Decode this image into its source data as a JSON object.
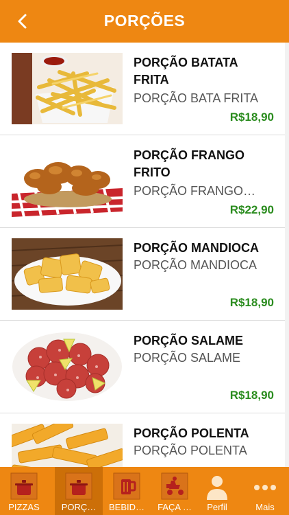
{
  "header": {
    "title": "PORÇÕES",
    "back_icon": "chevron-left-icon"
  },
  "items": [
    {
      "name": "PORÇÃO BATATA FRITA",
      "description": "PORÇÃO BATA FRITA",
      "price": "R$18,90"
    },
    {
      "name": "PORÇÃO FRANGO FRITO",
      "description": "PORÇÃO FRANGO…",
      "price": "R$22,90"
    },
    {
      "name": "PORÇÃO MANDIOCA",
      "description": "PORÇÃO MANDIOCA",
      "price": "R$18,90"
    },
    {
      "name": "PORÇÃO SALAME",
      "description": "PORÇÃO SALAME",
      "price": "R$18,90"
    },
    {
      "name": "PORÇÃO POLENTA",
      "description": "PORÇÃO POLENTA",
      "price": ""
    }
  ],
  "tabs": [
    {
      "label": "PIZZAS",
      "icon": "pot-icon"
    },
    {
      "label": "PORÇ…",
      "icon": "pot-icon",
      "active": true
    },
    {
      "label": "BEBID…",
      "icon": "beer-mug-icon"
    },
    {
      "label": "FAÇA …",
      "icon": "delivery-scooter-icon"
    },
    {
      "label": "Perfil",
      "icon": "user-profile-icon"
    },
    {
      "label": "Mais",
      "icon": "more-dots-icon"
    }
  ],
  "colors": {
    "primary": "#ee8712",
    "active_tab": "#cc6f08",
    "price": "#2a8c1e"
  }
}
